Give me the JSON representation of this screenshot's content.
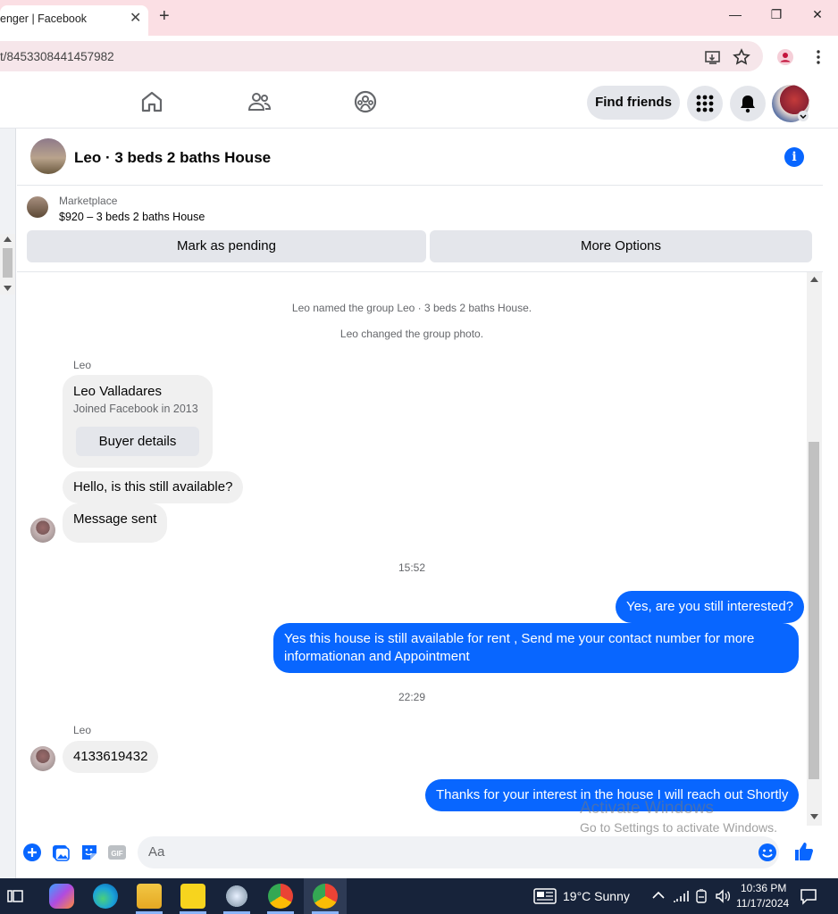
{
  "browser": {
    "tab_title": "enger | Facebook",
    "tab_close": "✕",
    "new_tab": "+",
    "minimize": "—",
    "restore": "❐",
    "close": "✕",
    "url": "t/8453308441457982"
  },
  "header": {
    "find_friends": "Find friends"
  },
  "chat": {
    "title": "Leo · 3 beds 2 baths House",
    "info": "i"
  },
  "marketplace": {
    "label": "Marketplace",
    "listing": "$920 – 3 beds 2 baths House",
    "mark_pending": "Mark as pending",
    "more_options": "More Options"
  },
  "messages": {
    "sys1": "Leo named the group Leo · 3 beds 2 baths House.",
    "sys2": "Leo changed the group photo.",
    "sender1": "Leo",
    "card_name": "Leo Valladares",
    "card_sub": "Joined Facebook in 2013",
    "card_button": "Buyer details",
    "msg1": "Hello, is this still available?",
    "msg2": "Message sent",
    "time1": "15:52",
    "out1": "Yes, are you still interested?",
    "out2_line1": "Yes this house is still available for rent , Send me your contact number for more",
    "out2_line2": "informationan and Appointment",
    "time2": "22:29",
    "sender2": "Leo",
    "msg3": "4133619432",
    "out3": "Thanks for your interest in the house I will reach out Shortly"
  },
  "composer": {
    "placeholder": "Aa",
    "gif": "GIF"
  },
  "watermark": {
    "line1": "Activate Windows",
    "line2": "Go to Settings to activate Windows."
  },
  "taskbar": {
    "weather": "19°C  Sunny",
    "time": "10:36 PM",
    "date": "11/17/2024"
  },
  "colors": {
    "accent": "#0866ff",
    "tab_strip": "#fbdfe4",
    "taskbar": "#17233a"
  }
}
